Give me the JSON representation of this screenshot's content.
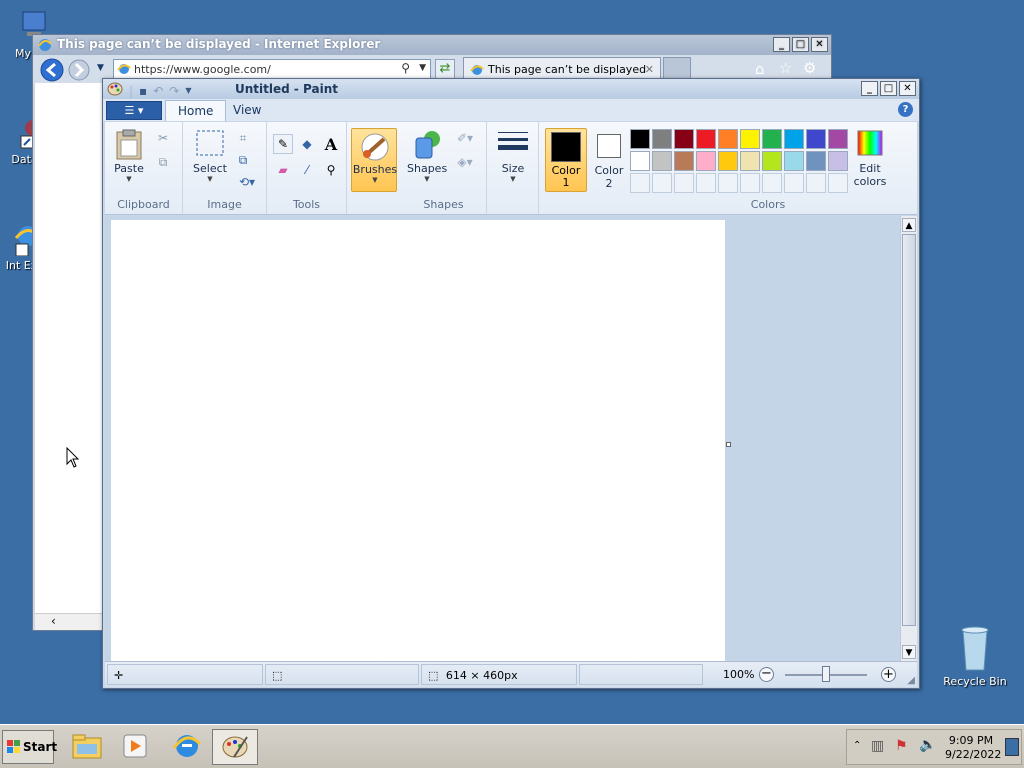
{
  "desktop": {
    "icons": [
      {
        "label": "My Co"
      },
      {
        "label": "DataW"
      },
      {
        "label": "Int Exp"
      },
      {
        "label": "Recycle Bin"
      }
    ]
  },
  "ie": {
    "title": "This page can’t be displayed - Internet Explorer",
    "url": "https://www.google.com/",
    "tab_label": "This page can’t be displayed"
  },
  "paint": {
    "title": "Untitled - Paint",
    "tabs": {
      "home": "Home",
      "view": "View"
    },
    "groups": {
      "clipboard": "Clipboard",
      "image": "Image",
      "tools": "Tools",
      "shapes": "Shapes",
      "colors": "Colors"
    },
    "buttons": {
      "paste": "Paste",
      "select": "Select",
      "brushes": "Brushes",
      "shapes": "Shapes",
      "size": "Size",
      "color1": "Color 1",
      "color2": "Color 2",
      "edit_colors": "Edit colors"
    },
    "colors": {
      "color1": "#000000",
      "color2": "#ffffff",
      "palette_row1": [
        "#000000",
        "#7f7f7f",
        "#880015",
        "#ed1c24",
        "#ff7f27",
        "#fff200",
        "#22b14c",
        "#00a2e8",
        "#3f48cc",
        "#a349a4"
      ],
      "palette_row2": [
        "#ffffff",
        "#c3c3c3",
        "#b97a57",
        "#ffaec9",
        "#ffc90e",
        "#efe4b0",
        "#b5e61d",
        "#99d9ea",
        "#7092be",
        "#c8bfe7"
      ]
    },
    "status": {
      "canvas_size": "614 × 460px",
      "zoom": "100%"
    }
  },
  "taskbar": {
    "start_label": "Start",
    "time": "9:09 PM",
    "date": "9/22/2022"
  }
}
